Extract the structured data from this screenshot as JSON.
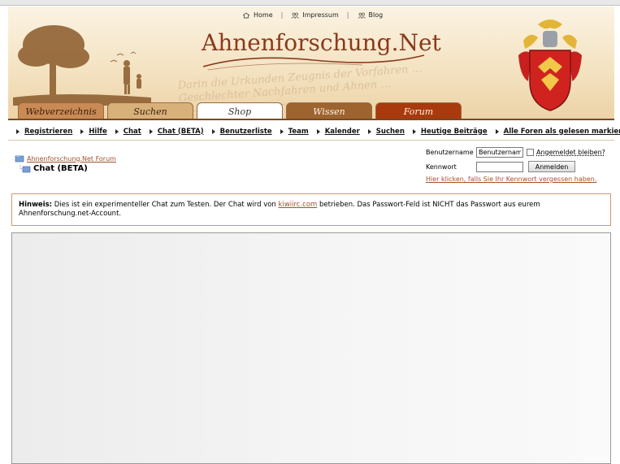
{
  "top_links": {
    "home": "Home",
    "impressum": "Impressum",
    "blog": "Blog",
    "separator": "|"
  },
  "logo": {
    "text": "Ahnenforschung.Net"
  },
  "tabs": [
    {
      "label": "Webverzeichnis"
    },
    {
      "label": "Suchen"
    },
    {
      "label": "Shop"
    },
    {
      "label": "Wissen"
    },
    {
      "label": "Forum"
    }
  ],
  "nav": [
    {
      "label": "Registrieren"
    },
    {
      "label": "Hilfe"
    },
    {
      "label": "Chat"
    },
    {
      "label": "Chat (BETA)"
    },
    {
      "label": "Benutzerliste"
    },
    {
      "label": "Team"
    },
    {
      "label": "Kalender"
    },
    {
      "label": "Suchen"
    },
    {
      "label": "Heutige Beiträge"
    },
    {
      "label": "Alle Foren als gelesen markieren"
    }
  ],
  "breadcrumb": {
    "forum_link": "Ahnenforschung.Net Forum",
    "current": "Chat (BETA)"
  },
  "login": {
    "username_label": "Benutzername",
    "username_value": "Benutzername",
    "remember_label": "Angemeldet bleiben?",
    "password_label": "Kennwort",
    "password_value": "",
    "submit_label": "Anmelden",
    "forgot_link": "Hier klicken, falls Sie Ihr Kennwort vergessen haben."
  },
  "notice": {
    "label": "Hinweis:",
    "text_before": " Dies ist ein experimenteller Chat zum Testen. Der Chat wird von ",
    "link": "kiwiirc.com",
    "text_after": " betrieben. Das Passwort-Feld ist NICHT das Passwort aus eurem Ahnenforschung.net-Account."
  },
  "colors": {
    "link_brown": "#a0522d",
    "logo_brown": "#8a3a1c",
    "tab_forum": "#a83a0e",
    "tab_wissen": "#9d6430",
    "notice_border": "#c99b6a"
  }
}
